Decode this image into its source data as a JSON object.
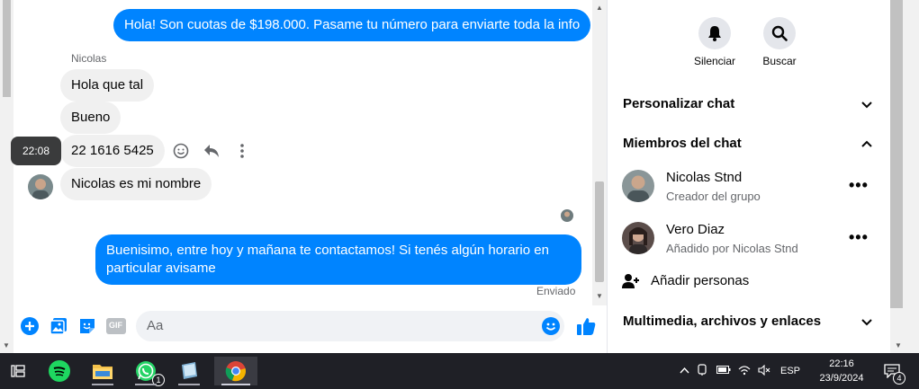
{
  "chat": {
    "messages": {
      "out_first": "Hola! Son cuotas de $198.000. Pasame tu número para enviarte toda la info",
      "sender_name": "Nicolas",
      "in_1": "Hola que tal",
      "in_2": "Bueno",
      "in_3": "22 1616 5425",
      "in_4": "Nicolas es mi nombre",
      "out_reply": "Buenisimo, entre hoy y mañana te contactamos! Si tenés algún horario en particular avisame",
      "status": "Enviado",
      "hover_time": "22:08"
    },
    "composer": {
      "placeholder": "Aa",
      "gif_label": "GIF"
    }
  },
  "info_panel": {
    "mute_label": "Silenciar",
    "search_label": "Buscar",
    "customize": "Personalizar chat",
    "members_title": "Miembros del chat",
    "members": [
      {
        "name": "Nicolas Stnd",
        "role": "Creador del grupo"
      },
      {
        "name": "Vero Diaz",
        "role": "Añadido por Nicolas Stnd"
      }
    ],
    "add_people": "Añadir personas",
    "media": "Multimedia, archivos y enlaces"
  },
  "taskbar": {
    "whatsapp_badge": "1",
    "lang": "ESP",
    "time": "22:16",
    "date": "23/9/2024",
    "notif_count": "4"
  },
  "colors": {
    "messenger_blue": "#0084ff",
    "bubble_gray": "#f0f0f0",
    "taskbar": "#1f2026"
  }
}
